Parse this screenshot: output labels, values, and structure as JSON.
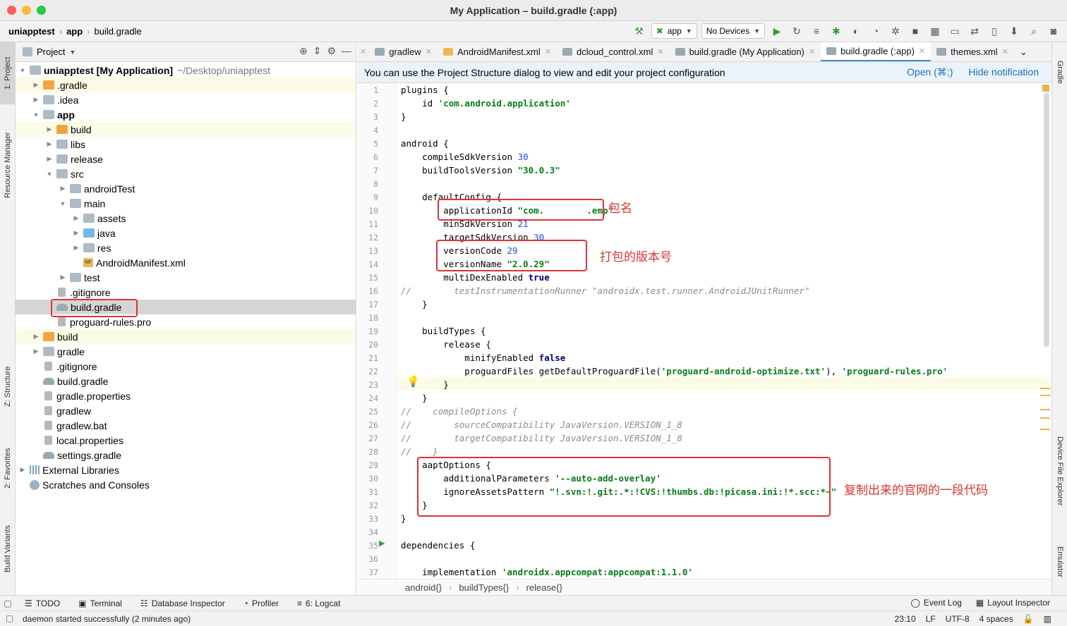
{
  "window": {
    "title": "My Application – build.gradle (:app)"
  },
  "navbar": {
    "breadcrumbs": [
      "uniapptest",
      "app",
      "build.gradle"
    ],
    "run_config": "app",
    "device": "No Devices"
  },
  "left_stripe": {
    "tabs": [
      "1: Project",
      "Resource Manager",
      "Z: Structure",
      "2: Favorites",
      "Build Variants"
    ]
  },
  "right_stripe": {
    "tabs": [
      "Gradle",
      "Device File Explorer",
      "Emulator"
    ]
  },
  "project": {
    "header": "Project",
    "tree": [
      {
        "label": "uniapptest [My Application]",
        "path": "~/Desktop/uniapptest",
        "icon": "folder",
        "bold": true
      },
      {
        "label": ".gradle",
        "icon": "folder-o"
      },
      {
        "label": ".idea",
        "icon": "folder"
      },
      {
        "label": "app",
        "icon": "folder",
        "bold": true
      },
      {
        "label": "build",
        "icon": "folder-o"
      },
      {
        "label": "libs",
        "icon": "folder"
      },
      {
        "label": "release",
        "icon": "folder"
      },
      {
        "label": "src",
        "icon": "folder"
      },
      {
        "label": "androidTest",
        "icon": "folder"
      },
      {
        "label": "main",
        "icon": "folder"
      },
      {
        "label": "assets",
        "icon": "folder"
      },
      {
        "label": "java",
        "icon": "folder-b"
      },
      {
        "label": "res",
        "icon": "folder"
      },
      {
        "label": "AndroidManifest.xml",
        "icon": "mf"
      },
      {
        "label": "test",
        "icon": "folder"
      },
      {
        "label": ".gitignore",
        "icon": "file"
      },
      {
        "label": "build.gradle",
        "icon": "gradle"
      },
      {
        "label": "proguard-rules.pro",
        "icon": "file"
      },
      {
        "label": "build",
        "icon": "folder-o"
      },
      {
        "label": "gradle",
        "icon": "folder"
      },
      {
        "label": ".gitignore",
        "icon": "file"
      },
      {
        "label": "build.gradle",
        "icon": "gradle"
      },
      {
        "label": "gradle.properties",
        "icon": "file"
      },
      {
        "label": "gradlew",
        "icon": "file"
      },
      {
        "label": "gradlew.bat",
        "icon": "file"
      },
      {
        "label": "local.properties",
        "icon": "file"
      },
      {
        "label": "settings.gradle",
        "icon": "gradle"
      },
      {
        "label": "External Libraries",
        "icon": "lib"
      },
      {
        "label": "Scratches and Consoles",
        "icon": "scratch"
      }
    ]
  },
  "editor": {
    "tabs": [
      {
        "label": "gradlew",
        "icon": "file"
      },
      {
        "label": "AndroidManifest.xml",
        "icon": "mf"
      },
      {
        "label": "dcloud_control.xml",
        "icon": "file"
      },
      {
        "label": "build.gradle (My Application)",
        "icon": "gradle"
      },
      {
        "label": "build.gradle (:app)",
        "icon": "gradle"
      },
      {
        "label": "themes.xml",
        "icon": "file"
      }
    ],
    "notification": {
      "text": "You can use the Project Structure dialog to view and edit your project configuration",
      "open_link": "Open (⌘;)",
      "hide_link": "Hide notification"
    },
    "line_numbers": [
      "1",
      "2",
      "3",
      "4",
      "5",
      "6",
      "7",
      "8",
      "9",
      "10",
      "11",
      "12",
      "13",
      "14",
      "15",
      "16",
      "17",
      "18",
      "19",
      "20",
      "21",
      "22",
      "23",
      "24",
      "25",
      "26",
      "27",
      "28",
      "29",
      "30",
      "31",
      "32",
      "33",
      "34",
      "35",
      "36",
      "37"
    ],
    "code_lines": [
      "plugins {",
      "    id 'com.android.application'",
      "}",
      "",
      "android {",
      "    compileSdkVersion 30",
      "    buildToolsVersion \"30.0.3\"",
      "",
      "    defaultConfig {",
      "        applicationId \"com.        .emp\"",
      "        minSdkVersion 21",
      "        targetSdkVersion 30",
      "        versionCode 29",
      "        versionName \"2.0.29\"",
      "        multiDexEnabled true",
      "//        testInstrumentationRunner \"androidx.test.runner.AndroidJUnitRunner\"",
      "    }",
      "",
      "    buildTypes {",
      "        release {",
      "            minifyEnabled false",
      "            proguardFiles getDefaultProguardFile('proguard-android-optimize.txt'), 'proguard-rules.pro'",
      "        }",
      "    }",
      "//    compileOptions {",
      "//        sourceCompatibility JavaVersion.VERSION_1_8",
      "//        targetCompatibility JavaVersion.VERSION_1_8",
      "//    }",
      "    aaptOptions {",
      "        additionalParameters '--auto-add-overlay'",
      "        ignoreAssetsPattern \"!.svn:!.git:.*:!CVS:!thumbs.db:!picasa.ini:!*.scc:*~\"",
      "    }",
      "}",
      "",
      "dependencies {",
      "",
      "    implementation 'androidx.appcompat:appcompat:1.1.0'"
    ],
    "breadcrumbs": [
      "android{}",
      "buildTypes{}",
      "release{}"
    ]
  },
  "annotations": {
    "package_name": "包名",
    "version": "打包的版本号",
    "copied_code": "复制出来的官网的一段代码"
  },
  "bottom_tabs": {
    "todo": "TODO",
    "terminal": "Terminal",
    "database_inspector": "Database Inspector",
    "profiler": "Profiler",
    "logcat": "6: Logcat",
    "event_log": "Event Log",
    "layout_inspector": "Layout Inspector"
  },
  "status": {
    "message": "daemon started successfully (2 minutes ago)",
    "position": "23:10",
    "line_sep": "LF",
    "encoding": "UTF-8",
    "indent": "4 spaces"
  },
  "colors": {
    "accent": "#4a88c7",
    "annotation": "#e33232"
  }
}
